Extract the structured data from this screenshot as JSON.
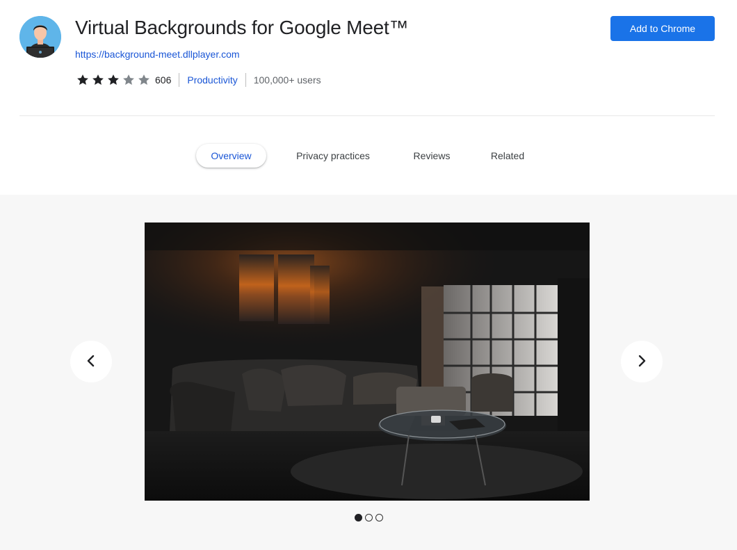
{
  "extension": {
    "title": "Virtual Backgrounds for Google Meet™",
    "url": "https://background-meet.dllplayer.com",
    "rating": 3,
    "rating_max": 5,
    "rating_count": "606",
    "category": "Productivity",
    "users": "100,000+ users",
    "icon": "avatar-person-laptop-icon"
  },
  "actions": {
    "add_label": "Add to Chrome"
  },
  "tabs": [
    {
      "label": "Overview",
      "active": true
    },
    {
      "label": "Privacy practices",
      "active": false
    },
    {
      "label": "Reviews",
      "active": false
    },
    {
      "label": "Related",
      "active": false
    }
  ],
  "gallery": {
    "slide_count": 3,
    "current_slide": 1,
    "prev_icon": "chevron-left-icon",
    "next_icon": "chevron-right-icon"
  },
  "colors": {
    "accent": "#1a73e8",
    "link": "#1a56d6",
    "star_filled": "#202124",
    "star_empty": "#80868b",
    "gallery_bg": "#f7f7f7"
  }
}
